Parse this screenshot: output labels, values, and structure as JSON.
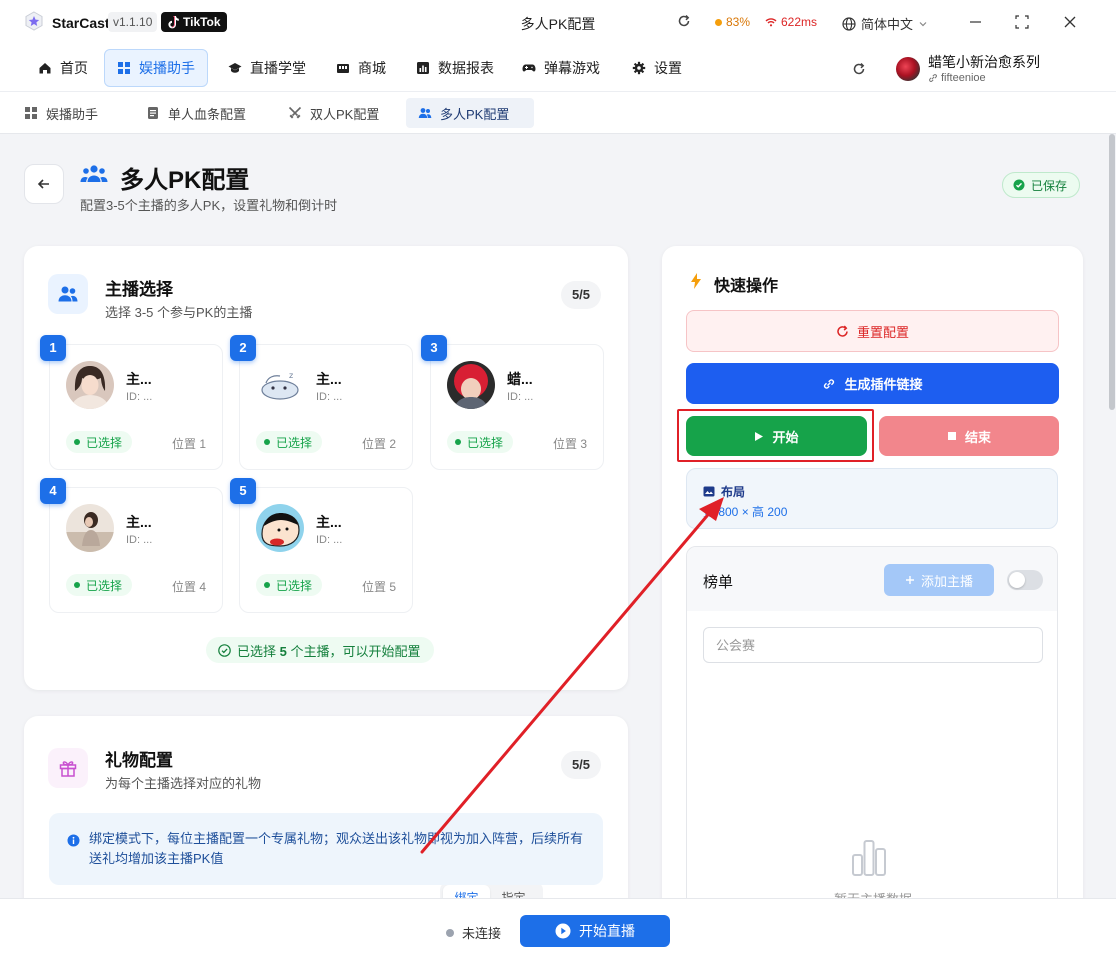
{
  "titlebar": {
    "app_name": "StarCast",
    "version": "v1.1.10",
    "platform": "TikTok",
    "window_title": "多人PK配置",
    "cpu": "83%",
    "ping": "622ms",
    "language": "简体中文"
  },
  "nav": {
    "items": [
      {
        "label": "首页",
        "icon": "home-icon"
      },
      {
        "label": "娱播助手",
        "icon": "grid-icon",
        "active": true
      },
      {
        "label": "直播学堂",
        "icon": "graduation-cap-icon"
      },
      {
        "label": "商城",
        "icon": "store-icon"
      },
      {
        "label": "数据报表",
        "icon": "chart-icon"
      },
      {
        "label": "弹幕游戏",
        "icon": "gamepad-icon"
      },
      {
        "label": "设置",
        "icon": "gear-icon"
      }
    ],
    "user_name": "蜡笔小新治愈系列",
    "user_handle": "fifteenioe"
  },
  "subtabs": [
    {
      "label": "娱播助手",
      "icon": "grid-icon"
    },
    {
      "label": "单人血条配置",
      "icon": "document-icon"
    },
    {
      "label": "双人PK配置",
      "icon": "swords-icon"
    },
    {
      "label": "多人PK配置",
      "icon": "users-icon",
      "active": true
    }
  ],
  "page": {
    "title": "多人PK配置",
    "subtitle": "配置3-5个主播的多人PK，设置礼物和倒计时",
    "saved": "已保存"
  },
  "host_select": {
    "title": "主播选择",
    "subtitle": "选择 3-5 个参与PK的主播",
    "count": "5/5",
    "hosts": [
      {
        "num": "1",
        "name": "主...",
        "id": "ID: ...",
        "status": "已选择",
        "pos": "位置 1"
      },
      {
        "num": "2",
        "name": "主...",
        "id": "ID: ...",
        "status": "已选择",
        "pos": "位置 2"
      },
      {
        "num": "3",
        "name": "蜡...",
        "id": "ID: ...",
        "status": "已选择",
        "pos": "位置 3"
      },
      {
        "num": "4",
        "name": "主...",
        "id": "ID: ...",
        "status": "已选择",
        "pos": "位置 4"
      },
      {
        "num": "5",
        "name": "主...",
        "id": "ID: ...",
        "status": "已选择",
        "pos": "位置 5"
      }
    ],
    "done_prefix": "已选择 ",
    "done_count": "5",
    "done_suffix": " 个主播，可以开始配置"
  },
  "gift_config": {
    "title": "礼物配置",
    "subtitle": "为每个主播选择对应的礼物",
    "mode_bind": "绑定",
    "mode_assign": "指定",
    "count": "5/5",
    "info": "绑定模式下，每位主播配置一个专属礼物；观众送出该礼物即视为加入阵营，后续所有送礼均增加该主播PK值"
  },
  "quick_ops": {
    "title": "快速操作",
    "reset": "重置配置",
    "gen_link": "生成插件链接",
    "start": "开始",
    "end": "结束",
    "layout_title": "布局",
    "layout_dims": "宽 800 × 高 200"
  },
  "ranking": {
    "title": "榜单",
    "add_host": "添加主播",
    "input_value": "",
    "input_placeholder": "公会赛",
    "empty_text": "暂无主播数据"
  },
  "bottom": {
    "status": "未连接",
    "live_button": "开始直播"
  },
  "colors": {
    "primary": "#1d6fe8",
    "success": "#16a34a",
    "danger": "#f2868c",
    "annotation": "#e02027"
  }
}
